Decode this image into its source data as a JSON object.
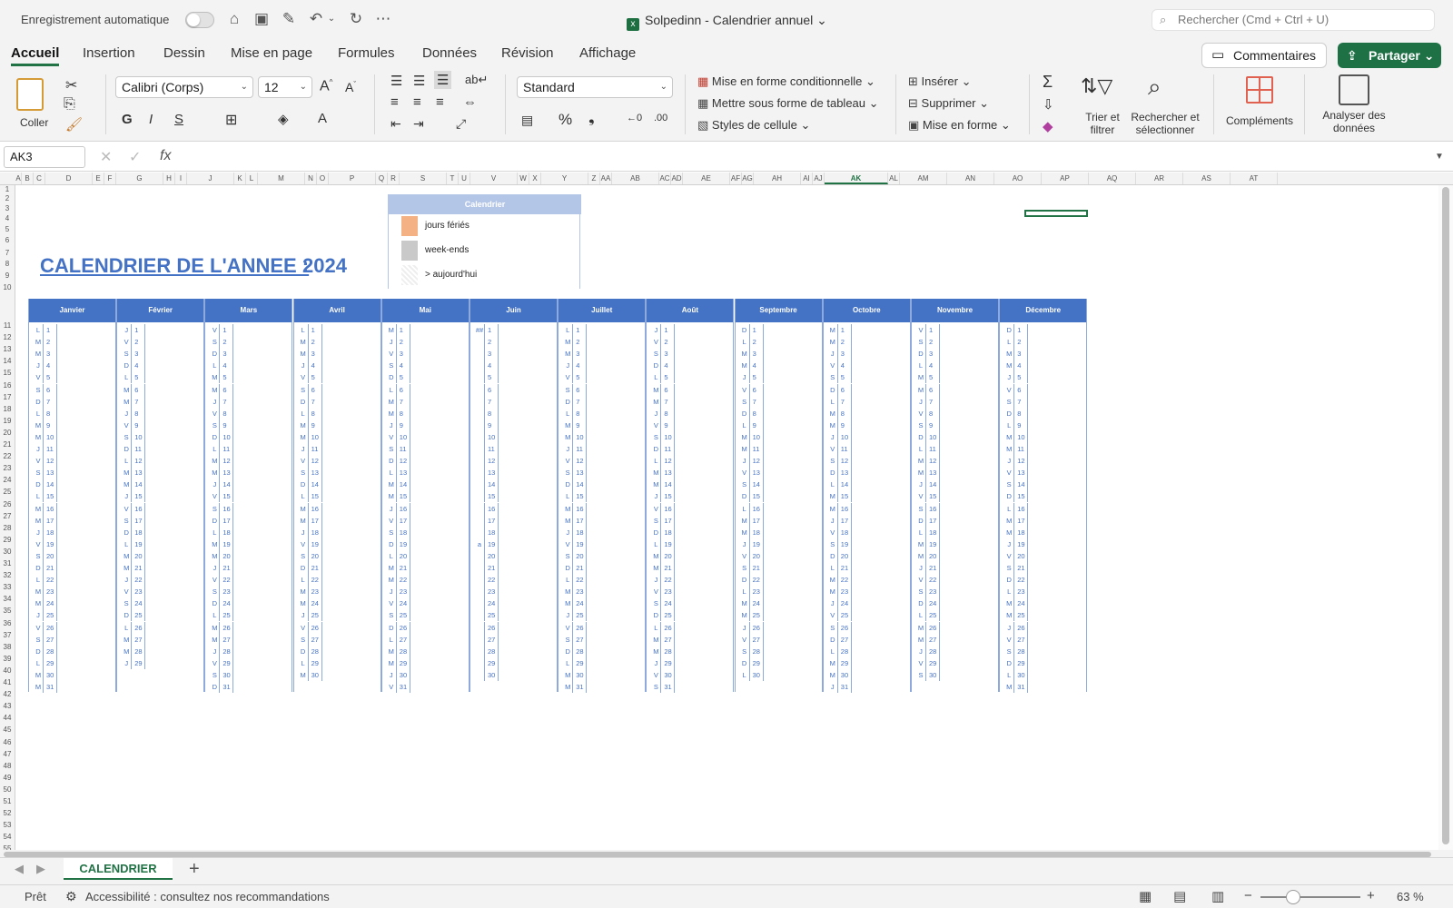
{
  "titlebar": {
    "autosave_label": "Enregistrement automatique",
    "doc_title": "Solpedinn - Calendrier annuel",
    "search_placeholder": "Rechercher (Cmd + Ctrl + U)"
  },
  "ribbon_tabs": [
    "Accueil",
    "Insertion",
    "Dessin",
    "Mise en page",
    "Formules",
    "Données",
    "Révision",
    "Affichage"
  ],
  "actions": {
    "comments": "Commentaires",
    "share": "Partager"
  },
  "ribbon": {
    "paste": "Coller",
    "font_name": "Calibri (Corps)",
    "font_size": "12",
    "bold": "G",
    "italic": "I",
    "underline": "S",
    "number_format": "Standard",
    "conditional_format": "Mise en forme conditionnelle",
    "format_as_table": "Mettre sous forme de tableau",
    "cell_styles": "Styles de cellule",
    "insert": "Insérer",
    "delete": "Supprimer",
    "format": "Mise en forme",
    "sort_filter": "Trier et filtrer",
    "find_select": "Rechercher et sélectionner",
    "addins": "Compléments",
    "analyze": "Analyser des données"
  },
  "formula_bar": {
    "name_box": "AK3",
    "formula": ""
  },
  "columns": [
    "A",
    "B",
    "C",
    "D",
    "E",
    "F",
    "G",
    "H",
    "I",
    "J",
    "K",
    "L",
    "M",
    "N",
    "O",
    "P",
    "Q",
    "R",
    "S",
    "T",
    "U",
    "V",
    "W",
    "X",
    "Y",
    "Z",
    "AA",
    "AB",
    "AC",
    "AD",
    "AE",
    "AF",
    "AG",
    "AH",
    "AI",
    "AJ",
    "AK",
    "AL",
    "AM",
    "AN",
    "AO",
    "AP",
    "AQ",
    "AR",
    "AS",
    "AT"
  ],
  "rows": [
    "1",
    "2",
    "3",
    "4",
    "5",
    "6",
    "7",
    "8",
    "9",
    "10",
    "11",
    "12",
    "13",
    "14",
    "15",
    "16",
    "17",
    "18",
    "19",
    "20",
    "21",
    "22",
    "23",
    "24",
    "25",
    "26",
    "27",
    "28",
    "29",
    "30",
    "31",
    "32",
    "33",
    "34",
    "35",
    "36",
    "37",
    "38",
    "39",
    "40",
    "41",
    "42",
    "43",
    "44",
    "45",
    "46",
    "47",
    "48",
    "49",
    "50",
    "51",
    "52",
    "53",
    "54",
    "55"
  ],
  "sheet": {
    "title": "CALENDRIER DE L'ANNEE :",
    "year": "2024",
    "legend_header": "Calendrier",
    "legend": [
      {
        "label": "jours fériés",
        "color": "#f4b183"
      },
      {
        "label": "week-ends",
        "color": "#c9c9c9"
      },
      {
        "label": "> aujourd'hui",
        "color": "#f2f2f2"
      }
    ],
    "months": [
      {
        "name": "Janvier",
        "letters": "LMMJVSDLMMJVSDLMMJVSDLMMJVSDLMM"
      },
      {
        "name": "Février",
        "letters": "JVSDLMMJVSDLMMJVSDLMMJVSDLMMJ"
      },
      {
        "name": "Mars",
        "letters": "VSDLMMJVSDLMMJVSDLMMJVSDLMMJVSD"
      },
      {
        "name": "Avril",
        "letters": "LMMJVSDLMMJVSDLMMJVSDLMMJVSDLM"
      },
      {
        "name": "Mai",
        "letters": "MJVSDLMMJVSDLMMJVSDLMMJVSDLMMJV"
      },
      {
        "name": "Juin",
        "letters": "",
        "first_cell": "##",
        "marker_row": 19,
        "marker": "a"
      },
      {
        "name": "Juillet",
        "letters": "LMMJVSDLMMJVSDLMMJVSDLMMJVSDLMM"
      },
      {
        "name": "Août",
        "letters": "JVSDLMMJVSDLMMJVSDLMMJVSDLMMJVS"
      },
      {
        "name": "Septembre",
        "letters": "DLMMJVSDLMMJVSDLMMJVSDLMMJVSDL"
      },
      {
        "name": "Octobre",
        "letters": "MMJVSDLMMJVSDLMMJVSDLMMJVSDLMMJ"
      },
      {
        "name": "Novembre",
        "letters": "VSDLMMJVSDLMMJVSDLMMJVSDLMMJVS"
      },
      {
        "name": "Décembre",
        "letters": "DLMMJVSDLMMJVSDLMMJVSDLMMJVSDLM"
      }
    ],
    "month_lengths": [
      31,
      29,
      31,
      30,
      31,
      30,
      31,
      31,
      30,
      31,
      30,
      31
    ]
  },
  "sheet_tab": "CALENDRIER",
  "status": {
    "ready": "Prêt",
    "accessibility": "Accessibilité : consultez nos recommandations",
    "zoom": "63 %"
  }
}
